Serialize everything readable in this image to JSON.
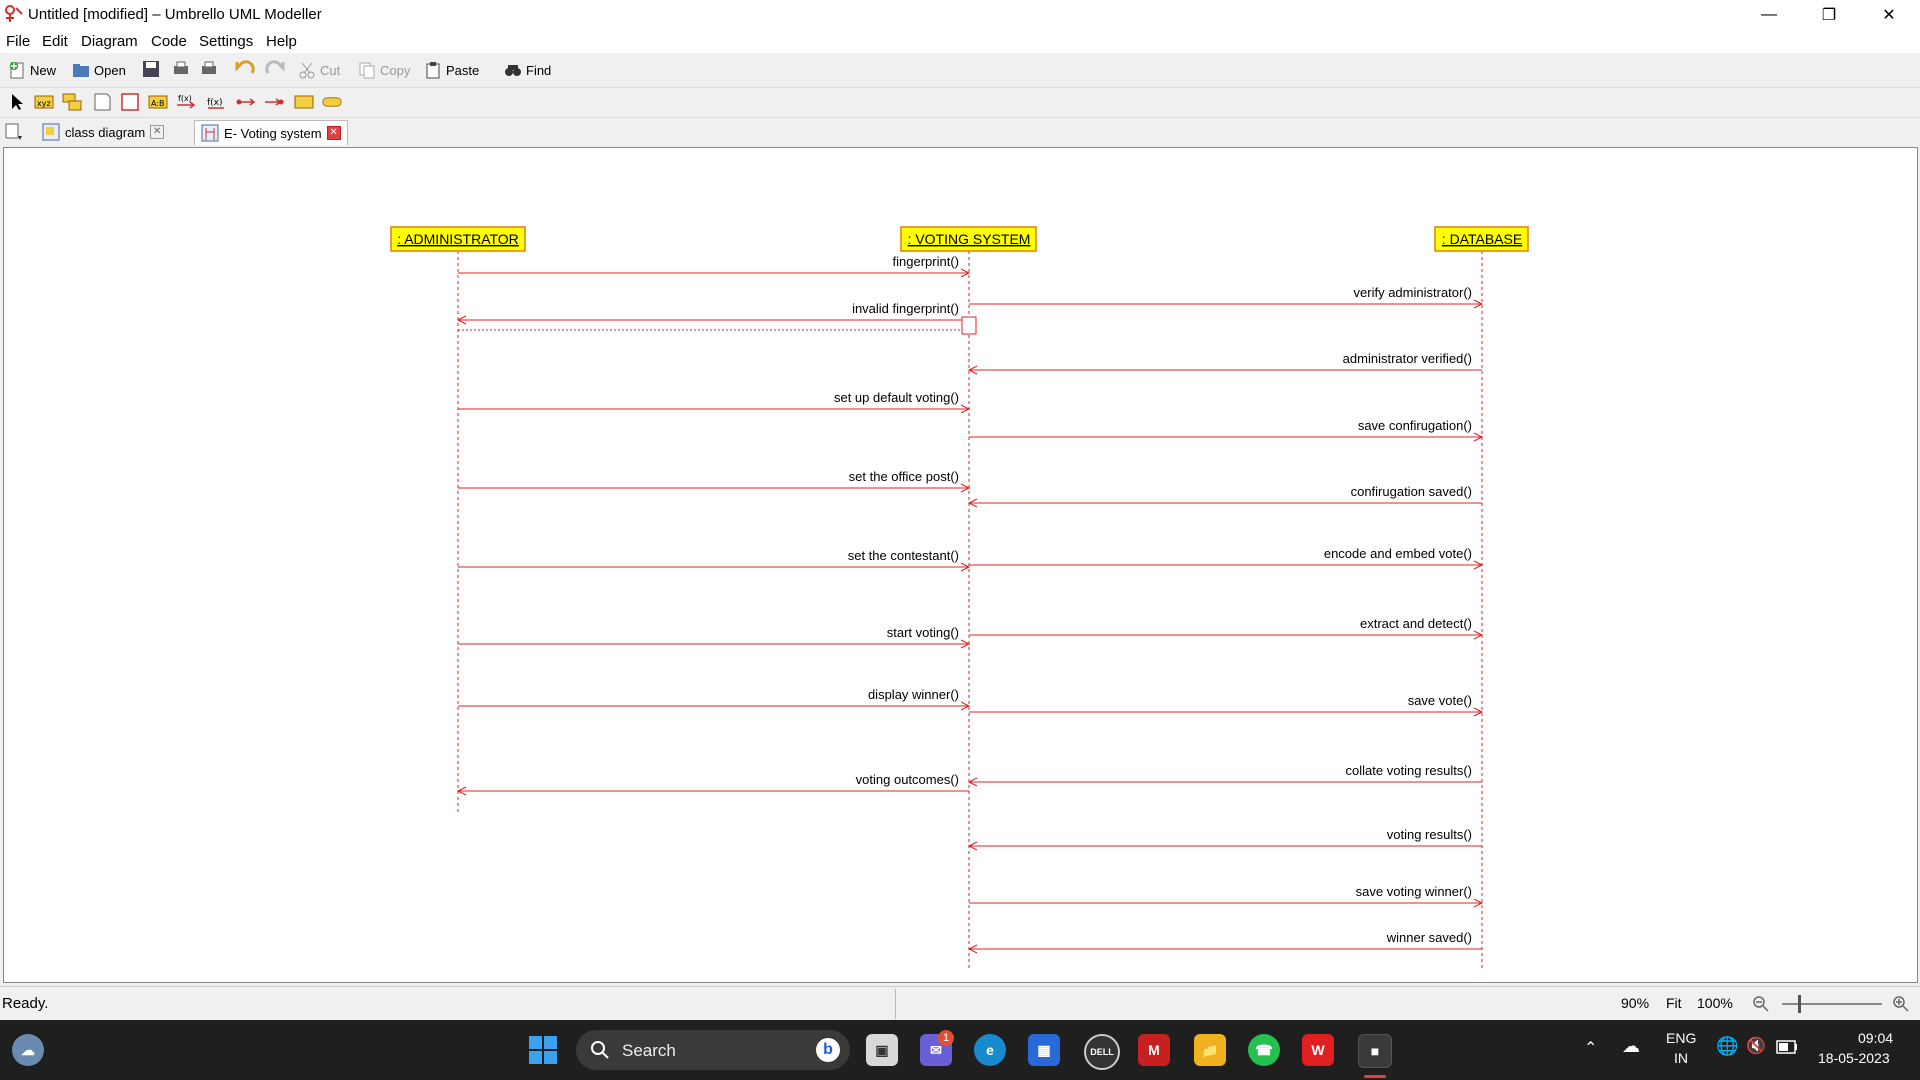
{
  "window": {
    "title": "Untitled [modified] – Umbrello UML Modeller"
  },
  "menu": [
    "File",
    "Edit",
    "Diagram",
    "Code",
    "Settings",
    "Help"
  ],
  "toolbar": {
    "new": "New",
    "open": "Open",
    "cut": "Cut",
    "copy": "Copy",
    "paste": "Paste",
    "find": "Find"
  },
  "tabs": [
    {
      "label": "class diagram"
    },
    {
      "label": "E- Voting system"
    }
  ],
  "diagram": {
    "lifelines": [
      ": ADMINISTRATOR",
      ": VOTING SYSTEM",
      ": DATABASE"
    ],
    "messages": [
      "fingerprint()",
      "invalid fingerprint()",
      "set up default voting()",
      "set the office post()",
      "set the contestant()",
      "start voting()",
      "display winner()",
      "voting outcomes()",
      "verify administrator()",
      "administrator verified()",
      "save confirugation()",
      "confirugation saved()",
      "encode and embed vote()",
      "extract and detect()",
      "save vote()",
      "collate voting results()",
      "voting results()",
      "save voting winner()",
      "winner saved()"
    ],
    "colors": {
      "line": "#e02020",
      "box_fill": "#ffff00",
      "box_border": "#e08000"
    }
  },
  "status": {
    "text": "Ready.",
    "zoom": "90%",
    "fit": "Fit",
    "hundred": "100%"
  },
  "taskbar": {
    "search": "Search",
    "lang1": "ENG",
    "lang2": "IN",
    "time": "09:04",
    "date": "18-05-2023",
    "badge": "1"
  }
}
